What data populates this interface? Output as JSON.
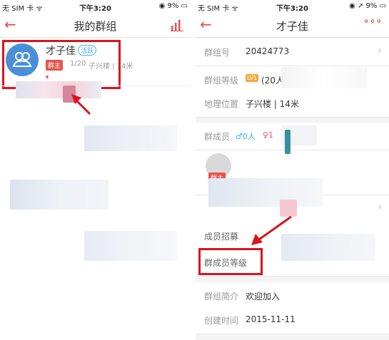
{
  "left": {
    "status": {
      "carrier": "无 SIM 卡 ᯤ",
      "time": "下午3:20",
      "battery": "◉ 9% ▭"
    },
    "nav": {
      "back": "←",
      "title": "我的群组"
    },
    "group": {
      "name": "才子佳",
      "tag": "活跃",
      "role": "群主",
      "members": "1/20",
      "location": "子兴楼 | 14米"
    }
  },
  "right": {
    "status": {
      "carrier": "无 SIM 卡 ᯤ",
      "time": "下午3:20",
      "battery": "◉ ➚ 9% ▭"
    },
    "nav": {
      "back": "←",
      "title": "才子佳",
      "more": "∘∘∘"
    },
    "rows": [
      {
        "key": "群组号",
        "value": "20424773"
      },
      {
        "key": "群组等级",
        "value": "(20人群)",
        "level": "LV1"
      },
      {
        "key": "地理位置",
        "value": "子兴楼 | 14米"
      },
      {
        "key": "群成员",
        "male": "♂0人",
        "female": "♀1"
      },
      {
        "key": "成员招募",
        "value": ""
      },
      {
        "key": "群成员等级",
        "value": ""
      },
      {
        "key": "群组简介",
        "value": "欢迎加入"
      },
      {
        "key": "创建时间",
        "value": "2015-11-11"
      }
    ],
    "owner_tag": "群主"
  },
  "colors": {
    "accent": "#e05050",
    "highlight": "#d8141e",
    "avatar": "#4a90d9"
  }
}
